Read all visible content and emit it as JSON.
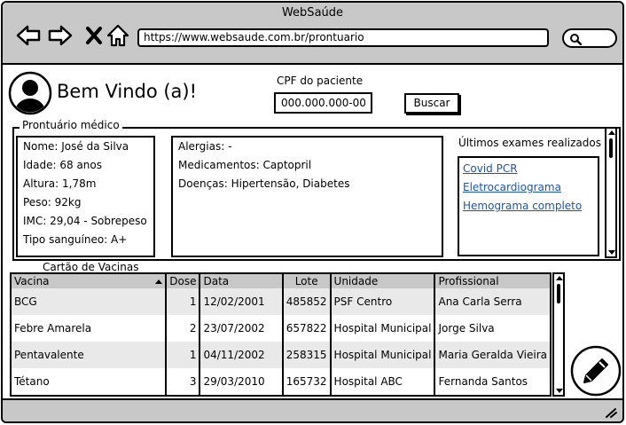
{
  "window": {
    "title": "WebSaúde"
  },
  "browser": {
    "url": "https://www.websaude.com.br/prontuario",
    "icons": [
      "back-arrow-icon",
      "forward-arrow-icon",
      "close-x-icon",
      "home-icon",
      "search-icon"
    ]
  },
  "header": {
    "welcome": "Bem Vindo (a)!",
    "cpf_label": "CPF do paciente",
    "cpf_value": "000.000.000-00",
    "search_label": "Buscar"
  },
  "record": {
    "legend": "Prontuário médico",
    "personal": [
      "Nome: José da Silva",
      "Idade: 68 anos",
      "Altura: 1,78m",
      "Peso: 92kg",
      "IMC: 29,04 - Sobrepeso",
      "Tipo sanguíneo: A+"
    ],
    "clinical": [
      "Alergias: -",
      "Medicamentos: Captopril",
      "Doenças: Hipertensão, Diabetes"
    ],
    "exams_title": "Últimos exames realizados",
    "exams": [
      "Covid PCR",
      "Eletrocardiograma",
      "Hemograma completo"
    ]
  },
  "vaccines": {
    "title": "Cartão de Vacinas",
    "columns": [
      "Vacina",
      "Dose",
      "Data",
      "Lote",
      "Unidade",
      "Profissional"
    ],
    "rows": [
      [
        "BCG",
        "1",
        "12/02/2001",
        "485852",
        "PSF Centro",
        "Ana Carla Serra"
      ],
      [
        "Febre Amarela",
        "2",
        "23/07/2002",
        "657822",
        "Hospital Municipal",
        "Jorge Silva"
      ],
      [
        "Pentavalente",
        "1",
        "04/11/2002",
        "258315",
        "Hospital Municipal",
        "Maria Geralda Vieira"
      ],
      [
        "Tétano",
        "3",
        "29/03/2010",
        "165732",
        "Hospital ABC",
        "Fernanda Santos"
      ]
    ]
  },
  "colors": {
    "chrome": "#c8c8c8",
    "link": "#1b57a8",
    "row_alt": "#e9e9e9"
  }
}
